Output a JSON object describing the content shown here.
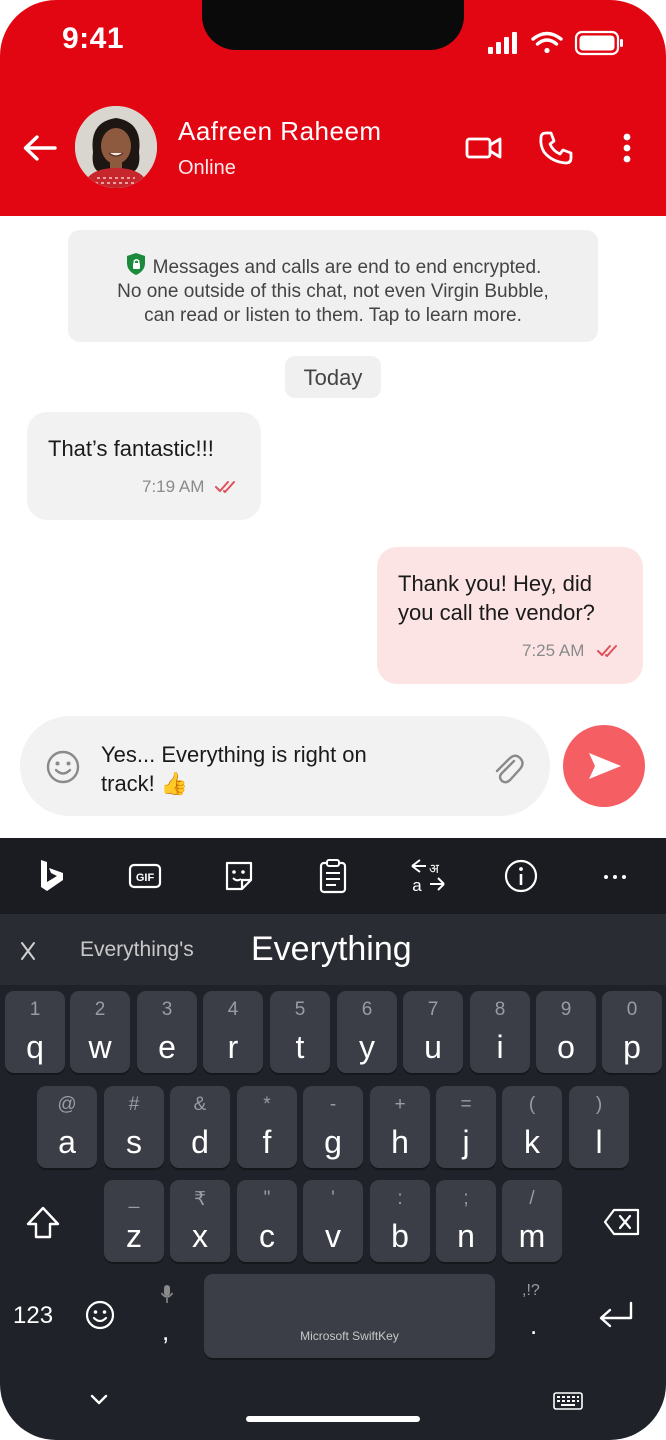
{
  "status_bar": {
    "time": "9:41"
  },
  "chat_header": {
    "contact_name": "Aafreen Raheem",
    "status": "Online"
  },
  "encryption_notice": {
    "line1": "Messages and calls are end to end encrypted.",
    "line2": "No one outside of this chat, not even Virgin Bubble,",
    "line3": "can read or listen to them. Tap to learn more."
  },
  "date_divider": "Today",
  "messages": [
    {
      "direction": "incoming",
      "line1": "That’s fantastic!!!",
      "time": "7:19 AM",
      "status": "read"
    },
    {
      "direction": "outgoing",
      "line1": "Thank you! Hey, did",
      "line2": "you call the vendor?",
      "time": "7:25 AM",
      "status": "read"
    }
  ],
  "composer": {
    "line1": "Yes... Everything is right on",
    "line2": "track! 👍"
  },
  "keyboard": {
    "suggestion_secondary": "Everything's",
    "suggestion_primary": "Everything",
    "row1": [
      {
        "hint": "1",
        "letter": "q"
      },
      {
        "hint": "2",
        "letter": "w"
      },
      {
        "hint": "3",
        "letter": "e"
      },
      {
        "hint": "4",
        "letter": "r"
      },
      {
        "hint": "5",
        "letter": "t"
      },
      {
        "hint": "6",
        "letter": "y"
      },
      {
        "hint": "7",
        "letter": "u"
      },
      {
        "hint": "8",
        "letter": "i"
      },
      {
        "hint": "9",
        "letter": "o"
      },
      {
        "hint": "0",
        "letter": "p"
      }
    ],
    "row2": [
      {
        "hint": "@",
        "letter": "a"
      },
      {
        "hint": "#",
        "letter": "s"
      },
      {
        "hint": "&",
        "letter": "d"
      },
      {
        "hint": "*",
        "letter": "f"
      },
      {
        "hint": "-",
        "letter": "g"
      },
      {
        "hint": "+",
        "letter": "h"
      },
      {
        "hint": "=",
        "letter": "j"
      },
      {
        "hint": "(",
        "letter": "k"
      },
      {
        "hint": ")",
        "letter": "l"
      }
    ],
    "row3": [
      {
        "hint": "_",
        "letter": "z"
      },
      {
        "hint": "₹",
        "letter": "x"
      },
      {
        "hint": "\"",
        "letter": "c"
      },
      {
        "hint": "'",
        "letter": "v"
      },
      {
        "hint": ":",
        "letter": "b"
      },
      {
        "hint": ";",
        "letter": "n"
      },
      {
        "hint": "/",
        "letter": "m"
      }
    ],
    "numbers_key": "123",
    "comma_key": ",",
    "period_key": ".",
    "period_hint": ",!?",
    "spacebar_label": "Microsoft SwiftKey",
    "toolbar_gif": "GIF"
  }
}
